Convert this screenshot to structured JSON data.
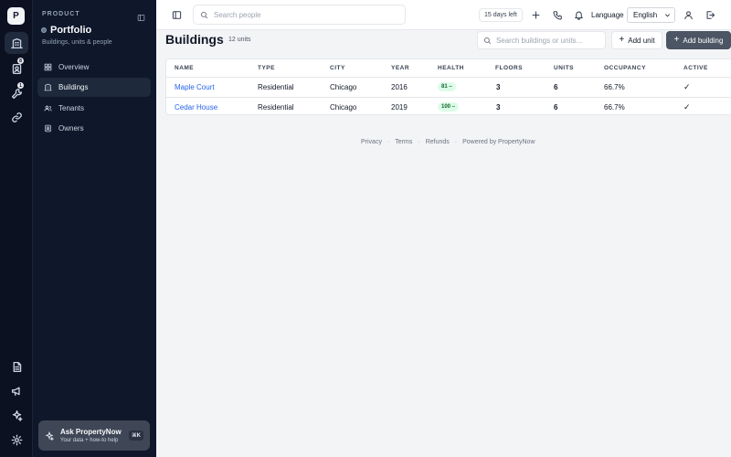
{
  "rail": {
    "logo_letter": "P",
    "badges": {
      "tenants": "8",
      "maintenance": "1"
    }
  },
  "sidebar": {
    "eyebrow": "PRODUCT",
    "title": "Portfolio",
    "subtitle": "Buildings, units & people",
    "items": [
      {
        "label": "Overview",
        "icon": "grid-icon",
        "active": false
      },
      {
        "label": "Buildings",
        "icon": "building-icon",
        "active": true
      },
      {
        "label": "Tenants",
        "icon": "users-icon",
        "active": false
      },
      {
        "label": "Owners",
        "icon": "owner-icon",
        "active": false
      }
    ],
    "ask": {
      "title": "Ask PropertyNow",
      "subtitle": "Your data + how-to help",
      "shortcut": "⌘K"
    }
  },
  "topbar": {
    "search_placeholder": "Search people",
    "trial": "15 days left",
    "language_label": "Language",
    "language_value": "English"
  },
  "main": {
    "title": "Buildings",
    "count": "12 units",
    "search_placeholder": "Search buildings or units...",
    "add_unit": "Add unit",
    "add_building": "Add building"
  },
  "table": {
    "columns": [
      "NAME",
      "TYPE",
      "CITY",
      "YEAR",
      "HEALTH",
      "FLOORS",
      "UNITS",
      "OCCUPANCY",
      "ACTIVE"
    ],
    "rows": [
      {
        "name": "Maple Court",
        "type": "Residential",
        "city": "Chicago",
        "year": "2016",
        "health": "81 –",
        "floors": "3",
        "units": "6",
        "occupancy": "66.7%",
        "active": "✓"
      },
      {
        "name": "Cedar House",
        "type": "Residential",
        "city": "Chicago",
        "year": "2019",
        "health": "100 –",
        "floors": "3",
        "units": "6",
        "occupancy": "66.7%",
        "active": "✓"
      }
    ]
  },
  "footer": {
    "links": [
      "Privacy",
      "Terms",
      "Refunds"
    ],
    "separator": "·",
    "powered": "Powered by PropertyNow"
  },
  "colors": {
    "rail_bg": "#0b1120",
    "sidebar_bg": "#0f172a",
    "accent_link": "#2563eb",
    "health_bg": "#dcfce7",
    "primary_button": "#4b5563"
  }
}
